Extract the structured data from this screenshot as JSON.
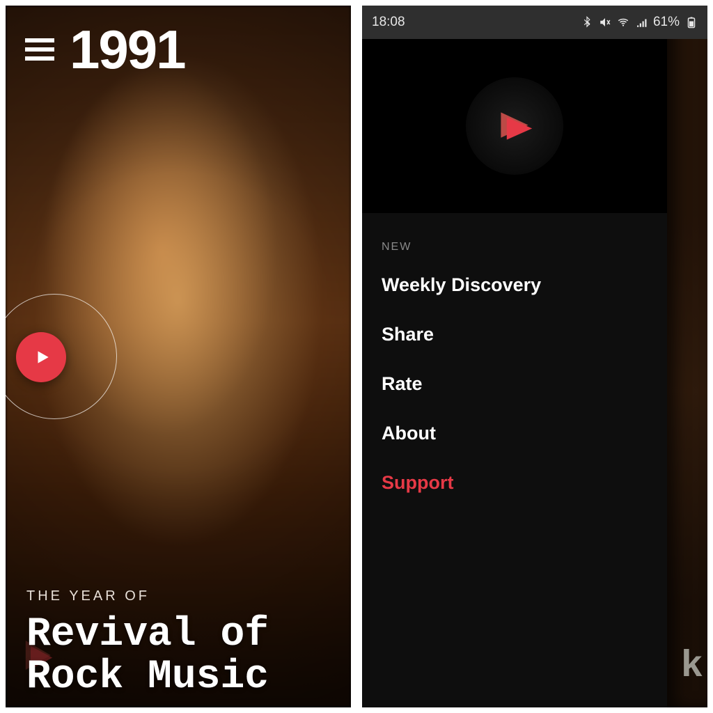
{
  "left": {
    "year": "1991",
    "eyebrow": "THE YEAR OF",
    "headline": "Revival of Rock Music"
  },
  "right": {
    "status": {
      "time": "18:08",
      "battery": "61%"
    },
    "menu": {
      "tag": "NEW",
      "items": [
        {
          "label": "Weekly Discovery",
          "accent": false
        },
        {
          "label": "Share",
          "accent": false
        },
        {
          "label": "Rate",
          "accent": false
        },
        {
          "label": "About",
          "accent": false
        },
        {
          "label": "Support",
          "accent": true
        }
      ]
    },
    "peek_letter": "k"
  },
  "colors": {
    "accent": "#e63946",
    "bg_dark": "#0e0e0e"
  }
}
